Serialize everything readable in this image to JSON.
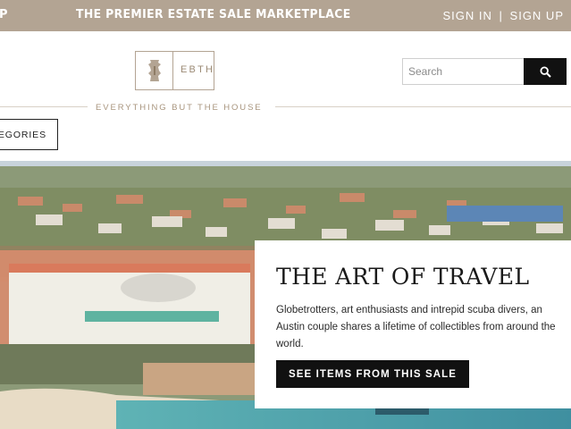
{
  "topbar": {
    "cut_label": "P",
    "marketing": "THE PREMIER ESTATE SALE MARKETPLACE",
    "sign_in": "SIGN IN",
    "separator": "|",
    "sign_up": "SIGN UP"
  },
  "brand": {
    "abbr": "EBTH",
    "tagline": "EVERYTHING BUT THE HOUSE"
  },
  "search": {
    "placeholder": "Search",
    "icon": "search-icon"
  },
  "nav": {
    "categories_label": "TEGORIES"
  },
  "hero": {
    "title": "THE ART OF TRAVEL",
    "description": "Globetrotters, art enthusiasts and intrepid scuba divers, an Austin couple shares a lifetime of collectibles from around the world.",
    "cta_label": "SEE ITEMS FROM THIS SALE"
  },
  "colors": {
    "topbar": "#b3a493",
    "brand_gold": "#a8957e",
    "button_dark": "#111111"
  }
}
